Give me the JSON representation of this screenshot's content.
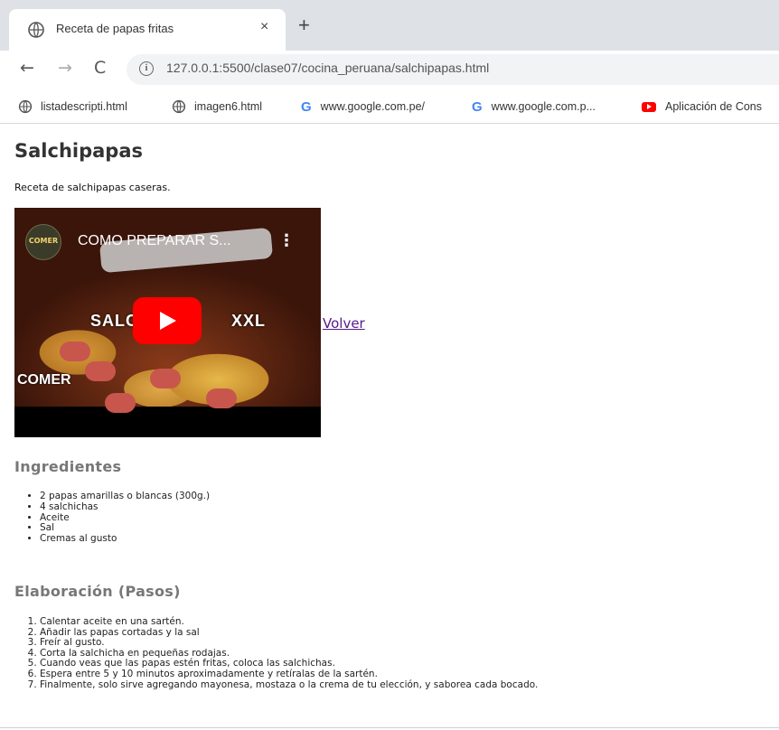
{
  "browser": {
    "tab_title": "Receta de papas fritas",
    "tab_close": "×",
    "new_tab": "+",
    "url": "127.0.0.1:5500/clase07/cocina_peruana/salchipapas.html",
    "nav": {
      "back": "←",
      "forward": "→",
      "reload": "C"
    },
    "bookmarks": [
      {
        "label": "listadescripti.html",
        "icon": "globe-icon"
      },
      {
        "label": "imagen6.html",
        "icon": "globe-icon"
      },
      {
        "label": "www.google.com.pe/",
        "icon": "google-icon"
      },
      {
        "label": "www.google.com.p...",
        "icon": "google-icon"
      },
      {
        "label": "Aplicación de Cons",
        "icon": "youtube-icon"
      }
    ]
  },
  "page": {
    "title": "Salchipapas",
    "intro": "Receta de salchipapas caseras.",
    "video": {
      "title": "COMO PREPARAR S...",
      "channel": "COMER",
      "overlay_left": "SALC",
      "overlay_right": "XXL",
      "watermark": "COMER"
    },
    "back_link": "Volver",
    "ingredients_heading": "Ingredientes",
    "ingredients": [
      "2 papas amarillas o blancas (300g.)",
      "4 salchichas",
      "Aceite",
      "Sal",
      "Cremas al gusto"
    ],
    "steps_heading": "Elaboración (Pasos)",
    "steps": [
      "Calentar aceite en una sartén.",
      "Añadir las papas cortadas y la sal",
      "Freír al gusto.",
      "Corta la salchicha en pequeñas rodajas.",
      "Cuando veas que las papas estén fritas, coloca las salchichas.",
      "Espera entre 5 y 10 minutos aproximadamente y retíralas de la sartén.",
      "Finalmente, solo sirve agregando mayonesa, mostaza o la crema de tu elección, y saborea cada bocado."
    ]
  }
}
